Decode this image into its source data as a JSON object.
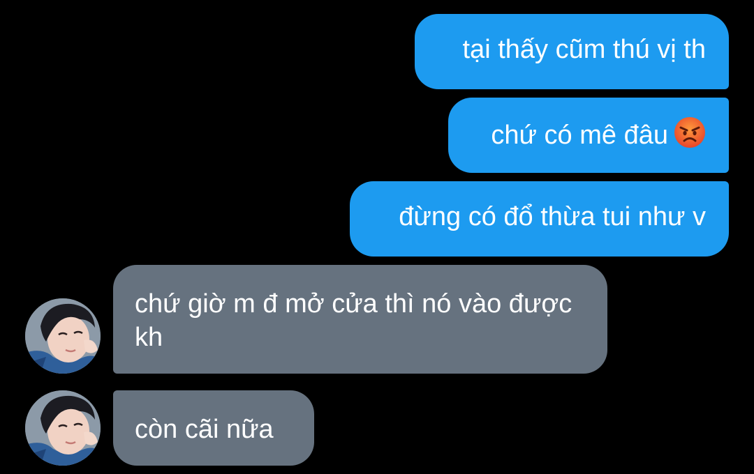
{
  "messages": [
    {
      "sender": "me",
      "text": "tại thấy cũm thú vị th"
    },
    {
      "sender": "me",
      "text": "chứ có mê đâu",
      "emoji": "angry-face-emoji"
    },
    {
      "sender": "me",
      "text": "đừng có đổ thừa tui như v"
    },
    {
      "sender": "other",
      "text": "chứ giờ m đ mở cửa thì nó vào được kh",
      "avatar": "contact-avatar"
    },
    {
      "sender": "other",
      "text": "còn cãi nữa",
      "avatar": "contact-avatar"
    }
  ],
  "colors": {
    "background": "#000000",
    "sent_bubble": "#1d9bf0",
    "received_bubble": "#66727f",
    "text": "#ffffff"
  }
}
